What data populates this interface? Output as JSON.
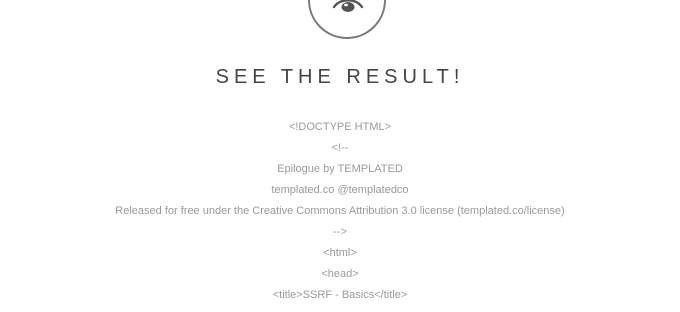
{
  "icon": {
    "name": "eye-icon"
  },
  "heading": "SEE THE RESULT!",
  "code_lines": [
    "<!DOCTYPE HTML>",
    "<!--",
    "Epilogue by TEMPLATED",
    "templated.co @templatedco",
    "Released for free under the Creative Commons Attribution 3.0 license (templated.co/license)",
    "-->",
    "<html>",
    "<head>",
    "<title>SSRF - Basics</title>"
  ],
  "colors": {
    "heading": "#444444",
    "code_text": "#9a9a9a",
    "icon_stroke": "#7a7a7a"
  }
}
